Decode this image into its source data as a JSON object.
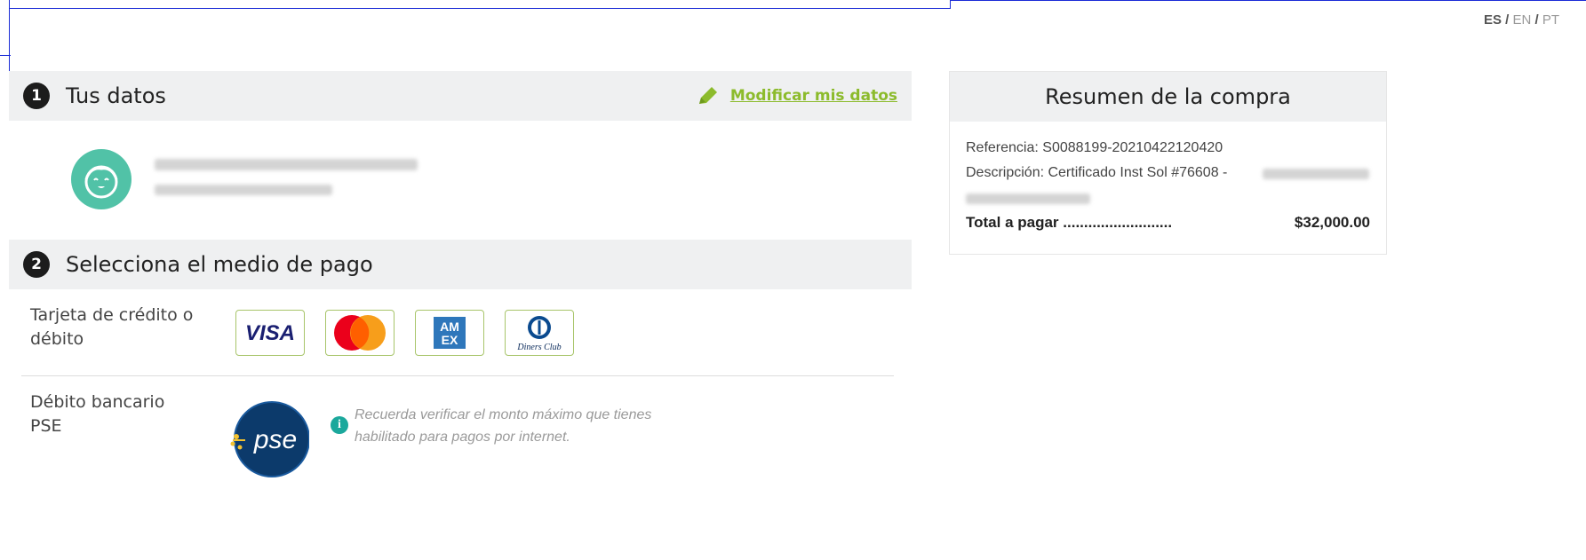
{
  "lang": {
    "es": "ES",
    "en": "EN",
    "pt": "PT",
    "sep": "/"
  },
  "step1": {
    "number": "1",
    "title": "Tus datos",
    "modify_label": "Modificar mis datos",
    "user_name_blurred": "",
    "user_email_blurred": ""
  },
  "step2": {
    "number": "2",
    "title": "Selecciona el medio de pago",
    "card_label_line1": "Tarjeta de crédito o",
    "card_label_line2": "débito",
    "cards": [
      {
        "name": "VISA",
        "icon": "visa-icon"
      },
      {
        "name": "Mastercard",
        "icon": "mastercard-icon"
      },
      {
        "name": "American Express",
        "icon": "amex-icon",
        "text": "AM EX"
      },
      {
        "name": "Diners Club",
        "icon": "diners-club-icon",
        "text": "Diners Club"
      }
    ],
    "pse_label_line1": "Débito bancario",
    "pse_label_line2": "PSE",
    "pse_logo_text": "pse",
    "pse_info_line1": "Recuerda verificar el monto máximo que tienes",
    "pse_info_line2": "habilitado para pagos por internet."
  },
  "summary": {
    "title": "Resumen de la compra",
    "reference": "Referencia: S0088199-20210422120420",
    "description": "Descripción: Certificado Inst Sol #76608 -",
    "total_label": "Total a pagar",
    "total_dots": "..........................",
    "total_value": "$32,000.00"
  },
  "colors": {
    "accent_green": "#8cbb2c",
    "avatar_teal": "#51c2a7",
    "header_bg": "#eff0f1",
    "pse_blue": "#0c3a6b",
    "info_teal": "#1ba89c"
  }
}
